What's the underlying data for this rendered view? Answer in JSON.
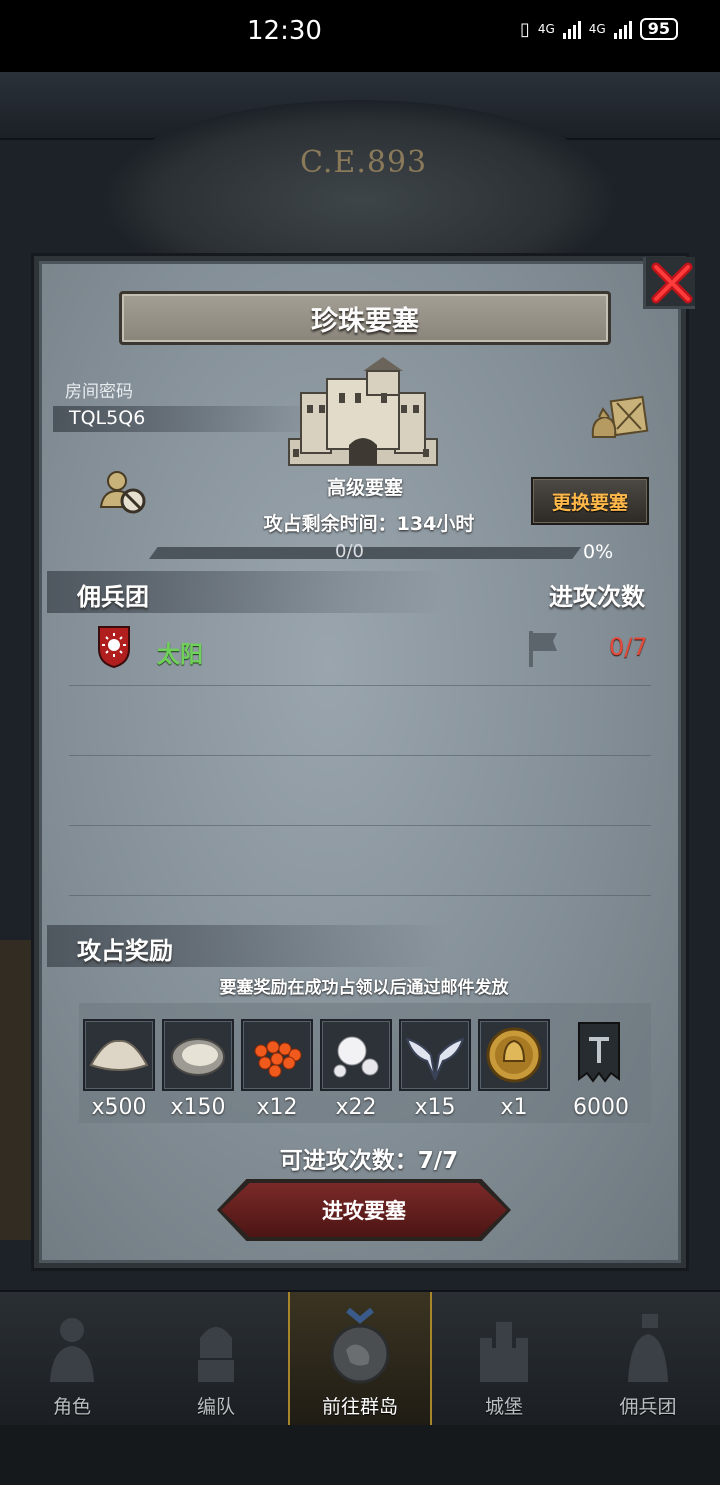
{
  "status_bar": {
    "time": "12:30",
    "net1": "4G",
    "net2": "4G",
    "battery": "95"
  },
  "background": {
    "year": "C.E.893"
  },
  "modal": {
    "title": "珍珠要塞",
    "room_password_label": "房间密码",
    "room_password": "TQL5Q6",
    "fortress_level": "高级要塞",
    "remaining_time": "攻占剩余时间：134小时",
    "change_button": "更换要塞",
    "progress": {
      "text": "0/0",
      "percent_label": "0%",
      "fraction": 0.0
    },
    "mercenary_header": "佣兵团",
    "attack_count_header": "进攻次数",
    "mercenaries": [
      {
        "name": "太阳",
        "attacks": "0/7"
      }
    ],
    "reward_header": "攻占奖励",
    "reward_note": "要塞奖励在成功占领以后通过邮件发放",
    "rewards": [
      {
        "icon": "sand-pile-icon",
        "qty": "x500"
      },
      {
        "icon": "oyster-icon",
        "qty": "x150"
      },
      {
        "icon": "fish-roe-icon",
        "qty": "x12"
      },
      {
        "icon": "pearl-icon",
        "qty": "x22"
      },
      {
        "icon": "winged-emblem-icon",
        "qty": "x15"
      },
      {
        "icon": "golden-helmet-coin-icon",
        "qty": "x1"
      },
      {
        "icon": "guild-banner-icon",
        "qty": "6000"
      }
    ],
    "attempts_left": "可进攻次数：7/7",
    "attack_button": "进攻要塞"
  },
  "bottom_nav": [
    {
      "label": "角色",
      "icon": "knight-icon"
    },
    {
      "label": "编队",
      "icon": "formation-icon"
    },
    {
      "label": "前往群岛",
      "icon": "island-globe-icon",
      "active": true
    },
    {
      "label": "城堡",
      "icon": "castle-icon"
    },
    {
      "label": "佣兵团",
      "icon": "mercenary-icon"
    }
  ]
}
